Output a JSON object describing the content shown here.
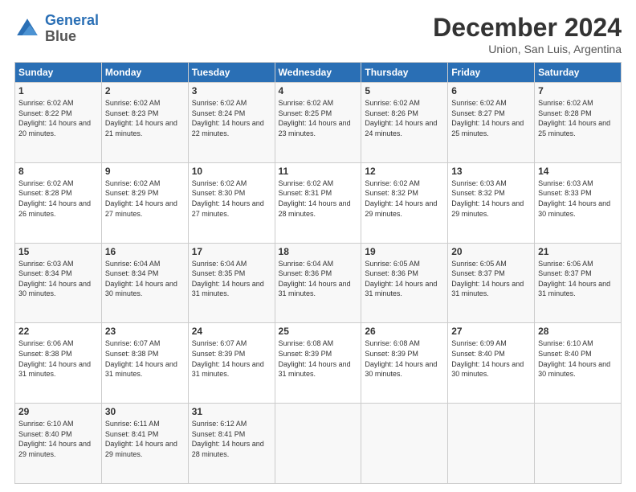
{
  "logo": {
    "line1": "General",
    "line2": "Blue"
  },
  "header": {
    "month": "December 2024",
    "location": "Union, San Luis, Argentina"
  },
  "weekdays": [
    "Sunday",
    "Monday",
    "Tuesday",
    "Wednesday",
    "Thursday",
    "Friday",
    "Saturday"
  ],
  "weeks": [
    [
      {
        "day": "1",
        "sunrise": "6:02 AM",
        "sunset": "8:22 PM",
        "daylight": "14 hours and 20 minutes."
      },
      {
        "day": "2",
        "sunrise": "6:02 AM",
        "sunset": "8:23 PM",
        "daylight": "14 hours and 21 minutes."
      },
      {
        "day": "3",
        "sunrise": "6:02 AM",
        "sunset": "8:24 PM",
        "daylight": "14 hours and 22 minutes."
      },
      {
        "day": "4",
        "sunrise": "6:02 AM",
        "sunset": "8:25 PM",
        "daylight": "14 hours and 23 minutes."
      },
      {
        "day": "5",
        "sunrise": "6:02 AM",
        "sunset": "8:26 PM",
        "daylight": "14 hours and 24 minutes."
      },
      {
        "day": "6",
        "sunrise": "6:02 AM",
        "sunset": "8:27 PM",
        "daylight": "14 hours and 25 minutes."
      },
      {
        "day": "7",
        "sunrise": "6:02 AM",
        "sunset": "8:28 PM",
        "daylight": "14 hours and 25 minutes."
      }
    ],
    [
      {
        "day": "8",
        "sunrise": "6:02 AM",
        "sunset": "8:28 PM",
        "daylight": "14 hours and 26 minutes."
      },
      {
        "day": "9",
        "sunrise": "6:02 AM",
        "sunset": "8:29 PM",
        "daylight": "14 hours and 27 minutes."
      },
      {
        "day": "10",
        "sunrise": "6:02 AM",
        "sunset": "8:30 PM",
        "daylight": "14 hours and 27 minutes."
      },
      {
        "day": "11",
        "sunrise": "6:02 AM",
        "sunset": "8:31 PM",
        "daylight": "14 hours and 28 minutes."
      },
      {
        "day": "12",
        "sunrise": "6:02 AM",
        "sunset": "8:32 PM",
        "daylight": "14 hours and 29 minutes."
      },
      {
        "day": "13",
        "sunrise": "6:03 AM",
        "sunset": "8:32 PM",
        "daylight": "14 hours and 29 minutes."
      },
      {
        "day": "14",
        "sunrise": "6:03 AM",
        "sunset": "8:33 PM",
        "daylight": "14 hours and 30 minutes."
      }
    ],
    [
      {
        "day": "15",
        "sunrise": "6:03 AM",
        "sunset": "8:34 PM",
        "daylight": "14 hours and 30 minutes."
      },
      {
        "day": "16",
        "sunrise": "6:04 AM",
        "sunset": "8:34 PM",
        "daylight": "14 hours and 30 minutes."
      },
      {
        "day": "17",
        "sunrise": "6:04 AM",
        "sunset": "8:35 PM",
        "daylight": "14 hours and 31 minutes."
      },
      {
        "day": "18",
        "sunrise": "6:04 AM",
        "sunset": "8:36 PM",
        "daylight": "14 hours and 31 minutes."
      },
      {
        "day": "19",
        "sunrise": "6:05 AM",
        "sunset": "8:36 PM",
        "daylight": "14 hours and 31 minutes."
      },
      {
        "day": "20",
        "sunrise": "6:05 AM",
        "sunset": "8:37 PM",
        "daylight": "14 hours and 31 minutes."
      },
      {
        "day": "21",
        "sunrise": "6:06 AM",
        "sunset": "8:37 PM",
        "daylight": "14 hours and 31 minutes."
      }
    ],
    [
      {
        "day": "22",
        "sunrise": "6:06 AM",
        "sunset": "8:38 PM",
        "daylight": "14 hours and 31 minutes."
      },
      {
        "day": "23",
        "sunrise": "6:07 AM",
        "sunset": "8:38 PM",
        "daylight": "14 hours and 31 minutes."
      },
      {
        "day": "24",
        "sunrise": "6:07 AM",
        "sunset": "8:39 PM",
        "daylight": "14 hours and 31 minutes."
      },
      {
        "day": "25",
        "sunrise": "6:08 AM",
        "sunset": "8:39 PM",
        "daylight": "14 hours and 31 minutes."
      },
      {
        "day": "26",
        "sunrise": "6:08 AM",
        "sunset": "8:39 PM",
        "daylight": "14 hours and 30 minutes."
      },
      {
        "day": "27",
        "sunrise": "6:09 AM",
        "sunset": "8:40 PM",
        "daylight": "14 hours and 30 minutes."
      },
      {
        "day": "28",
        "sunrise": "6:10 AM",
        "sunset": "8:40 PM",
        "daylight": "14 hours and 30 minutes."
      }
    ],
    [
      {
        "day": "29",
        "sunrise": "6:10 AM",
        "sunset": "8:40 PM",
        "daylight": "14 hours and 29 minutes."
      },
      {
        "day": "30",
        "sunrise": "6:11 AM",
        "sunset": "8:41 PM",
        "daylight": "14 hours and 29 minutes."
      },
      {
        "day": "31",
        "sunrise": "6:12 AM",
        "sunset": "8:41 PM",
        "daylight": "14 hours and 28 minutes."
      },
      null,
      null,
      null,
      null
    ]
  ]
}
